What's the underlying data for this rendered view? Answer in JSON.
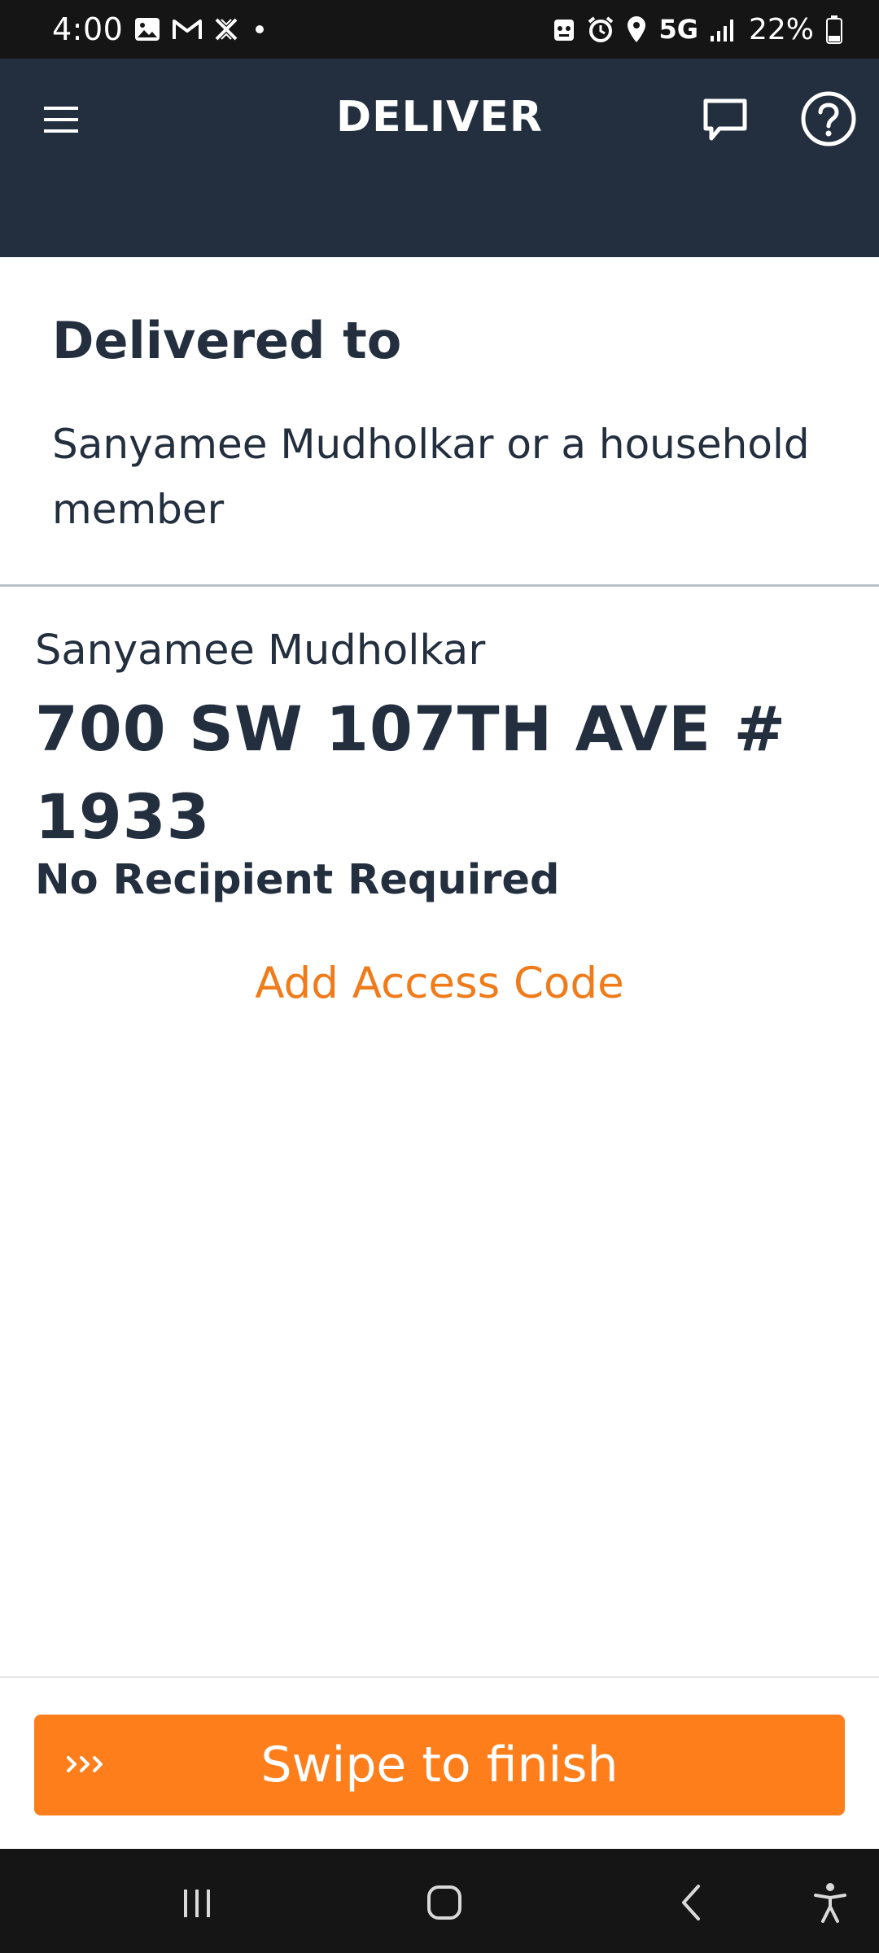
{
  "status_bar": {
    "time": "4:00",
    "network": "5G",
    "battery": "22%",
    "icons": [
      "gallery-icon",
      "gmail-icon",
      "x-app-icon",
      "dot-icon",
      "robot-icon",
      "alarm-icon",
      "location-icon",
      "signal-icon",
      "battery-icon"
    ]
  },
  "header": {
    "title": "DELIVER",
    "icons": [
      "menu-icon",
      "chat-icon",
      "help-icon"
    ]
  },
  "delivered": {
    "title": "Delivered to",
    "description": "Sanyamee Mudholkar or a household member"
  },
  "address_card": {
    "recipient": "Sanyamee Mudholkar",
    "address": "700 SW 107TH AVE # 1933",
    "note": "No Recipient Required",
    "access_link": "Add Access Code"
  },
  "swipe": {
    "label": "Swipe to finish",
    "icon": "chevrons-right-icon"
  },
  "nav_bar": {
    "icons": [
      "recents-icon",
      "home-icon",
      "back-icon",
      "accessibility-icon"
    ]
  },
  "colors": {
    "header_bg": "#232f3e",
    "accent": "#ff7e1c",
    "link": "#f07b1a",
    "text": "#232f3e"
  }
}
